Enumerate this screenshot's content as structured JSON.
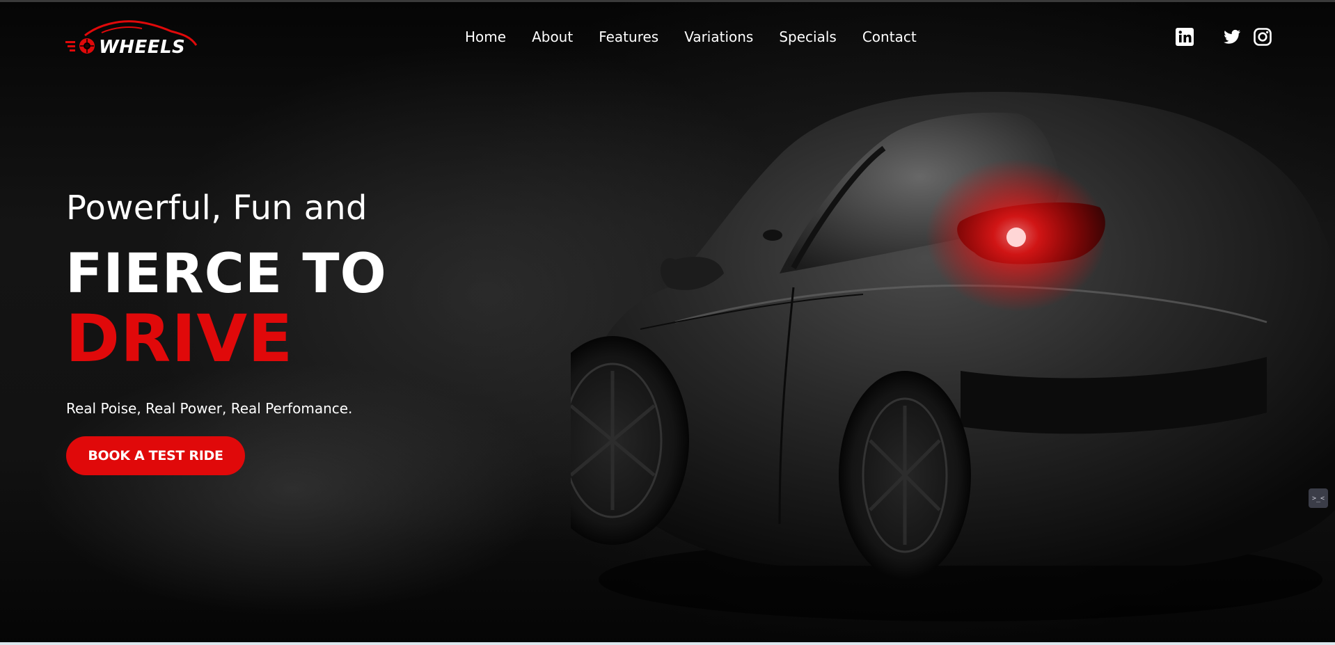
{
  "brand": {
    "name": "WHEELS",
    "accent_color": "#e0090a",
    "logo_icon": "car-wheel-logo"
  },
  "nav": {
    "items": [
      {
        "label": "Home"
      },
      {
        "label": "About"
      },
      {
        "label": "Features"
      },
      {
        "label": "Variations"
      },
      {
        "label": "Specials"
      },
      {
        "label": "Contact"
      }
    ]
  },
  "socials": {
    "icons": [
      "linkedin-icon",
      "twitter-icon",
      "instagram-icon"
    ]
  },
  "hero": {
    "tagline": "Powerful, Fun and",
    "headline_1": "FIERCE TO",
    "headline_2": "DRIVE",
    "subtext": "Real Poise, Real Power, Real Perfomance.",
    "cta_label": "BOOK A TEST RIDE",
    "image": "black-sports-car-rear-view"
  },
  "widget": {
    "icon": "terminal-widget-icon"
  }
}
